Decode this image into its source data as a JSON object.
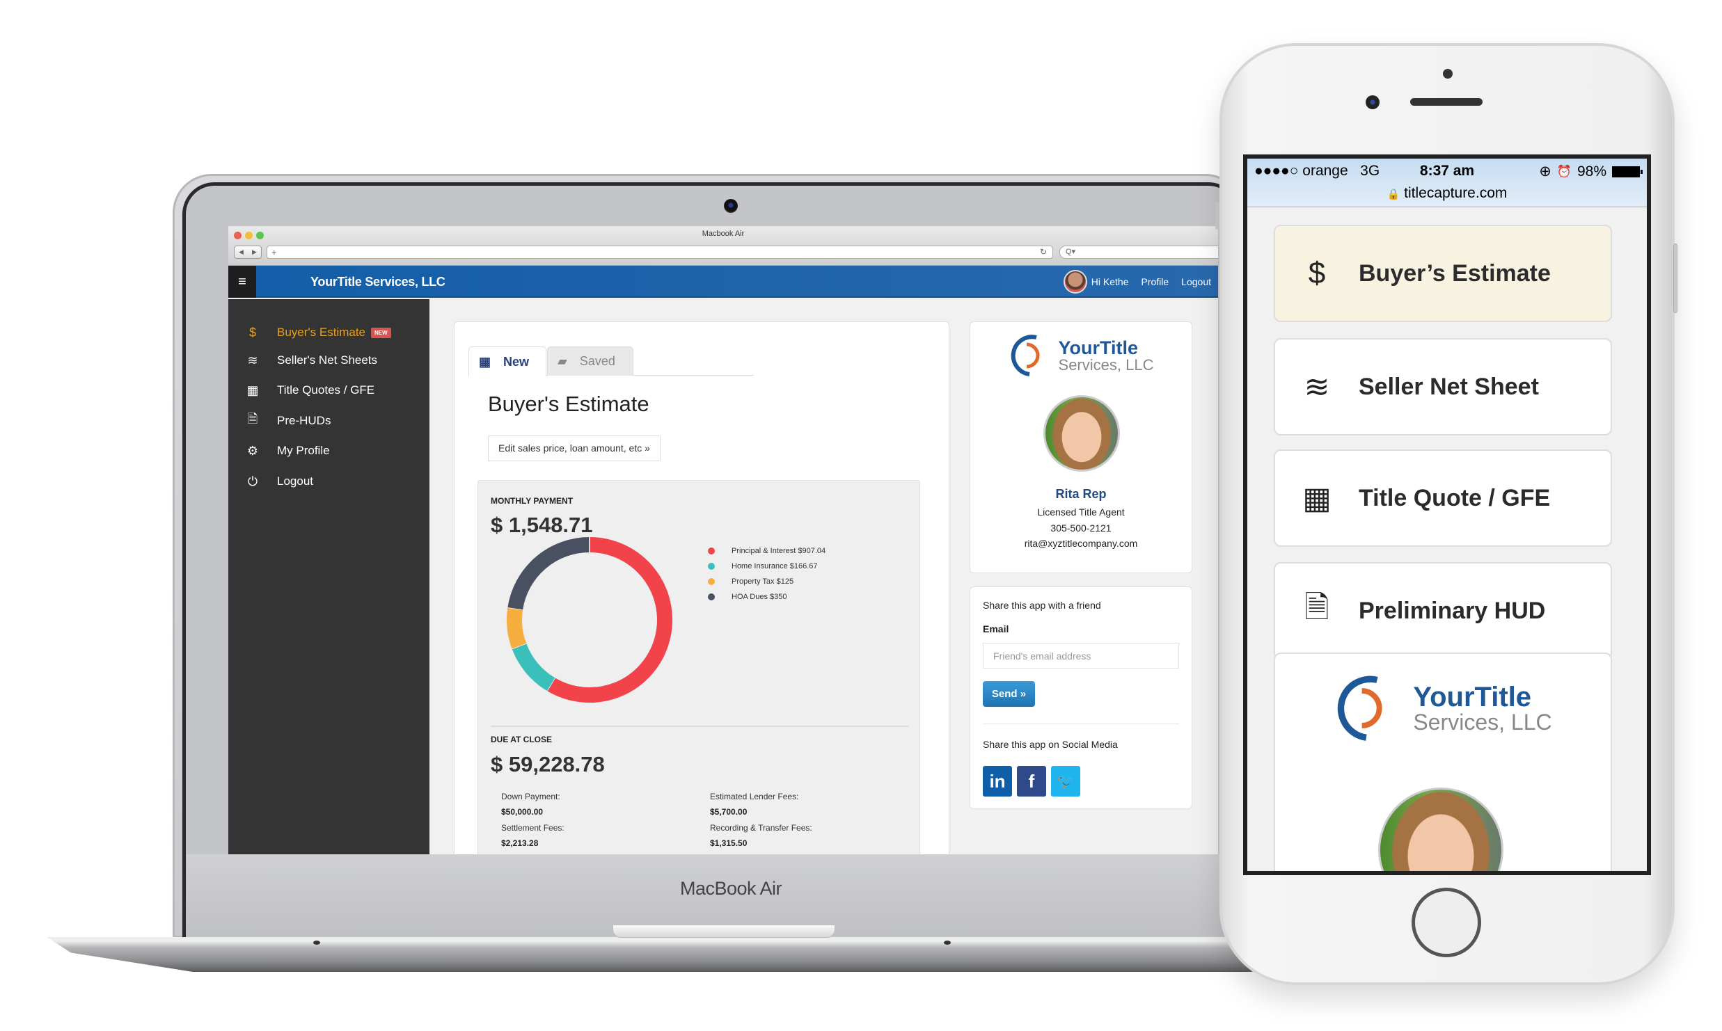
{
  "laptop": {
    "brand": "MacBook Air",
    "browser": {
      "window_title": "Macbook Air",
      "url": "+",
      "search_icon": "Q▾",
      "reload_icon": "↻",
      "nav_back": "◀",
      "nav_forward": "▶"
    },
    "header": {
      "menu_icon": "≡",
      "title": "YourTitle Services, LLC",
      "greeting": "Hi Kethe",
      "profile_link": "Profile",
      "logout_link": "Logout"
    },
    "sidebar": {
      "items": [
        {
          "icon": "$",
          "label": "Buyer's Estimate",
          "badge": "NEW",
          "active": true
        },
        {
          "icon": "≋",
          "label": "Seller's Net Sheets"
        },
        {
          "icon": "▦",
          "label": "Title Quotes / GFE"
        },
        {
          "icon": "🗎",
          "label": "Pre-HUDs"
        },
        {
          "icon": "⚙",
          "label": "My Profile"
        },
        {
          "icon": "⏻",
          "label": "Logout"
        }
      ]
    },
    "main": {
      "tabs": [
        {
          "icon": "▦",
          "label": "New",
          "active": true
        },
        {
          "icon": "▰",
          "label": "Saved"
        }
      ],
      "title": "Buyer's Estimate",
      "edit_button": "Edit sales price, loan amount, etc »",
      "monthly": {
        "label": "MONTHLY PAYMENT",
        "amount": "$ 1,548.71"
      },
      "due": {
        "label": "DUE AT CLOSE",
        "amount": "$ 59,228.78",
        "fees": [
          {
            "label": "Down Payment:",
            "value": "$50,000.00"
          },
          {
            "label": "Estimated Lender Fees:",
            "value": "$5,700.00"
          },
          {
            "label": "Settlement Fees:",
            "value": "$2,213.28"
          },
          {
            "label": "Recording & Transfer Fees:",
            "value": "$1,315.50"
          }
        ]
      }
    },
    "agent": {
      "logo_line1": "YourTitle",
      "logo_line2": "Services, LLC",
      "name": "Rita Rep",
      "role": "Licensed Title Agent",
      "phone": "305-500-2121",
      "email": "rita@xyztitlecompany.com"
    },
    "share": {
      "title": "Share this app with a friend",
      "email_label": "Email",
      "email_placeholder": "Friend's email address",
      "email_value": "",
      "send_button": "Send »",
      "social_title": "Share this app on Social Media",
      "social": [
        {
          "name": "linkedin",
          "glyph": "in",
          "color": "#0e5fa8"
        },
        {
          "name": "facebook",
          "glyph": "f",
          "color": "#2f4a8a"
        },
        {
          "name": "twitter",
          "glyph": "🐦",
          "color": "#1fb4ec"
        }
      ]
    }
  },
  "colors": {
    "header_blue": "#1a62aa",
    "sidebar_bg": "#343434",
    "active_orange": "#e8a11f",
    "badge_red": "#d9534f",
    "logo_blue": "#1f5896",
    "logo_orange": "#e06a2c"
  },
  "chart_data": {
    "type": "pie",
    "style": "donut",
    "title": "MONTHLY PAYMENT",
    "total": 1548.71,
    "categories": [
      "Principal & Interest",
      "Home Insurance",
      "Property Tax",
      "HOA Dues"
    ],
    "values": [
      907.04,
      166.67,
      125,
      350
    ],
    "legend_labels": [
      "Principal & Interest $907.04",
      "Home Insurance $166.67",
      "Property Tax $125",
      "HOA Dues $350"
    ],
    "colors": [
      "#f2424a",
      "#3bbfbb",
      "#f6ae3f",
      "#495061"
    ],
    "legend": "right"
  },
  "phone": {
    "status": {
      "signal": "●●●●○",
      "carrier": "orange",
      "network": "3G",
      "time": "8:37 am",
      "rotation_icon": "⊕",
      "alarm_icon": "⏰",
      "battery": "98%"
    },
    "url": "titlecapture.com",
    "lock_icon": "🔒",
    "cards": [
      {
        "icon": "$",
        "label": "Buyer’s Estimate",
        "active": true
      },
      {
        "icon": "≋",
        "label": "Seller Net Sheet"
      },
      {
        "icon": "▦",
        "label": "Title Quote / GFE"
      },
      {
        "icon": "🗎",
        "label": "Preliminary HUD"
      }
    ],
    "agent": {
      "logo_line1": "YourTitle",
      "logo_line2": "Services, LLC"
    }
  }
}
